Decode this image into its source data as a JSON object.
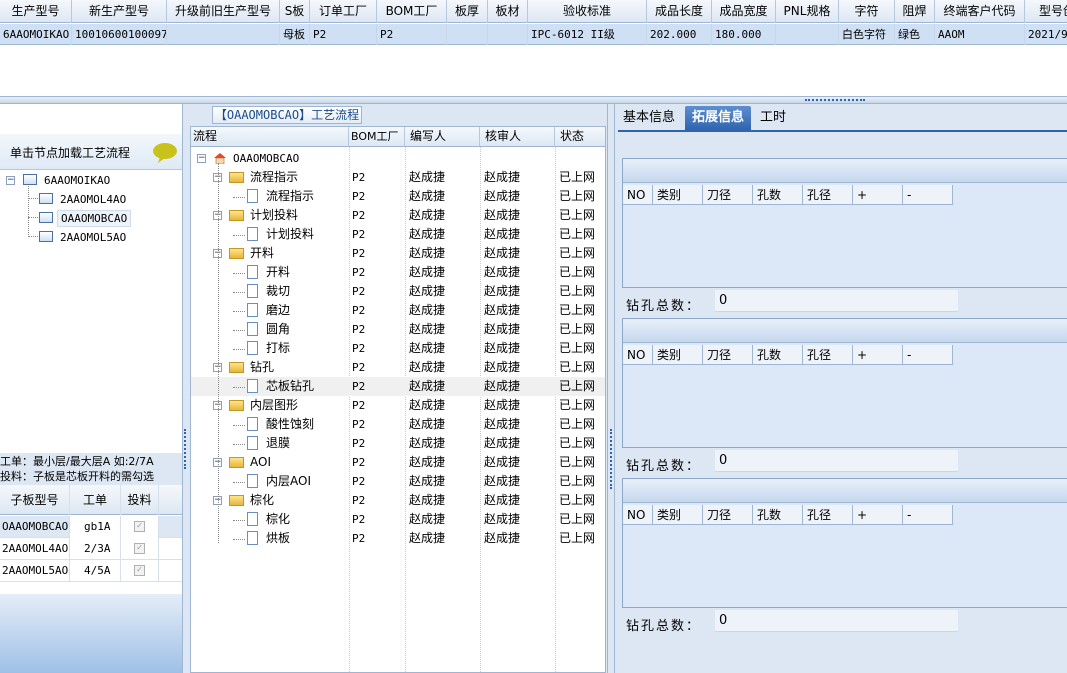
{
  "top_grid": {
    "headers": [
      "生产型号",
      "新生产型号",
      "升级前旧生产型号",
      "S板",
      "订单工厂",
      "BOM工厂",
      "板厚",
      "板材",
      "验收标准",
      "成品长度",
      "成品宽度",
      "PNL规格",
      "字符",
      "阻焊",
      "终端客户代码",
      "型号创"
    ],
    "row": [
      "6AAOMOIKAO",
      "10010600100097",
      "",
      "母板",
      "P2",
      "P2",
      "",
      "",
      "IPC-6012 II级",
      "202.000",
      "180.000",
      "",
      "白色字符",
      "绿色",
      "AAOM",
      "2021/9/"
    ]
  },
  "left": {
    "hint": "单击节点加载工艺流程",
    "tree_root": "6AAOMOIKAO",
    "tree_children": [
      "2AAOMOL4AO",
      "OAAOMOBCAO",
      "2AAOMOL5AO"
    ],
    "note_line1": "工单：最小层/最大层A 如:2/7A",
    "note_line2": "投料：子板是芯板开料的需勾选",
    "sub_headers": [
      "子板型号",
      "工单",
      "投料"
    ],
    "sub_rows": [
      {
        "model": "OAAOMOBCAO",
        "order": "gb1A",
        "check": "✓"
      },
      {
        "model": "2AAOMOL4AO",
        "order": "2/3A",
        "check": "✓"
      },
      {
        "model": "2AAOMOL5AO",
        "order": "4/5A",
        "check": "✓"
      }
    ]
  },
  "middle": {
    "title": "【OAAOMOBCAO】工艺流程",
    "headers": [
      "流程",
      "BOM工厂",
      "编写人",
      "核审人",
      "状态"
    ],
    "root": "OAAOMOBCAO",
    "rows": [
      {
        "name": "流程指示",
        "type": "folder",
        "bom": "P2",
        "writer": "赵成捷",
        "reviewer": "赵成捷",
        "status": "已上网"
      },
      {
        "name": "流程指示",
        "type": "doc",
        "bom": "P2",
        "writer": "赵成捷",
        "reviewer": "赵成捷",
        "status": "已上网"
      },
      {
        "name": "计划投料",
        "type": "folder",
        "bom": "P2",
        "writer": "赵成捷",
        "reviewer": "赵成捷",
        "status": "已上网"
      },
      {
        "name": "计划投料",
        "type": "doc",
        "bom": "P2",
        "writer": "赵成捷",
        "reviewer": "赵成捷",
        "status": "已上网"
      },
      {
        "name": "开料",
        "type": "folder",
        "bom": "P2",
        "writer": "赵成捷",
        "reviewer": "赵成捷",
        "status": "已上网"
      },
      {
        "name": "开料",
        "type": "doc",
        "bom": "P2",
        "writer": "赵成捷",
        "reviewer": "赵成捷",
        "status": "已上网"
      },
      {
        "name": "裁切",
        "type": "doc",
        "bom": "P2",
        "writer": "赵成捷",
        "reviewer": "赵成捷",
        "status": "已上网"
      },
      {
        "name": "磨边",
        "type": "doc",
        "bom": "P2",
        "writer": "赵成捷",
        "reviewer": "赵成捷",
        "status": "已上网"
      },
      {
        "name": "圆角",
        "type": "doc",
        "bom": "P2",
        "writer": "赵成捷",
        "reviewer": "赵成捷",
        "status": "已上网"
      },
      {
        "name": "打标",
        "type": "doc",
        "bom": "P2",
        "writer": "赵成捷",
        "reviewer": "赵成捷",
        "status": "已上网"
      },
      {
        "name": "钻孔",
        "type": "folder",
        "bom": "P2",
        "writer": "赵成捷",
        "reviewer": "赵成捷",
        "status": "已上网"
      },
      {
        "name": "芯板钻孔",
        "type": "doc",
        "bom": "P2",
        "writer": "赵成捷",
        "reviewer": "赵成捷",
        "status": "已上网"
      },
      {
        "name": "内层图形",
        "type": "folder",
        "bom": "P2",
        "writer": "赵成捷",
        "reviewer": "赵成捷",
        "status": "已上网"
      },
      {
        "name": "酸性蚀刻",
        "type": "doc",
        "bom": "P2",
        "writer": "赵成捷",
        "reviewer": "赵成捷",
        "status": "已上网"
      },
      {
        "name": "退膜",
        "type": "doc",
        "bom": "P2",
        "writer": "赵成捷",
        "reviewer": "赵成捷",
        "status": "已上网"
      },
      {
        "name": "AOI",
        "type": "folder",
        "bom": "P2",
        "writer": "赵成捷",
        "reviewer": "赵成捷",
        "status": "已上网"
      },
      {
        "name": "内层AOI",
        "type": "doc",
        "bom": "P2",
        "writer": "赵成捷",
        "reviewer": "赵成捷",
        "status": "已上网"
      },
      {
        "name": "棕化",
        "type": "folder",
        "bom": "P2",
        "writer": "赵成捷",
        "reviewer": "赵成捷",
        "status": "已上网"
      },
      {
        "name": "棕化",
        "type": "doc",
        "bom": "P2",
        "writer": "赵成捷",
        "reviewer": "赵成捷",
        "status": "已上网"
      },
      {
        "name": "烘板",
        "type": "doc",
        "bom": "P2",
        "writer": "赵成捷",
        "reviewer": "赵成捷",
        "status": "已上网"
      }
    ]
  },
  "right": {
    "tabs": [
      "基本信息",
      "拓展信息",
      "工时"
    ],
    "drill_headers": [
      "NO",
      "类别",
      "刀径",
      "孔数",
      "孔径",
      "+",
      "-"
    ],
    "total_label": "钻孔总数：",
    "totals": [
      "0",
      "0",
      "0"
    ]
  }
}
